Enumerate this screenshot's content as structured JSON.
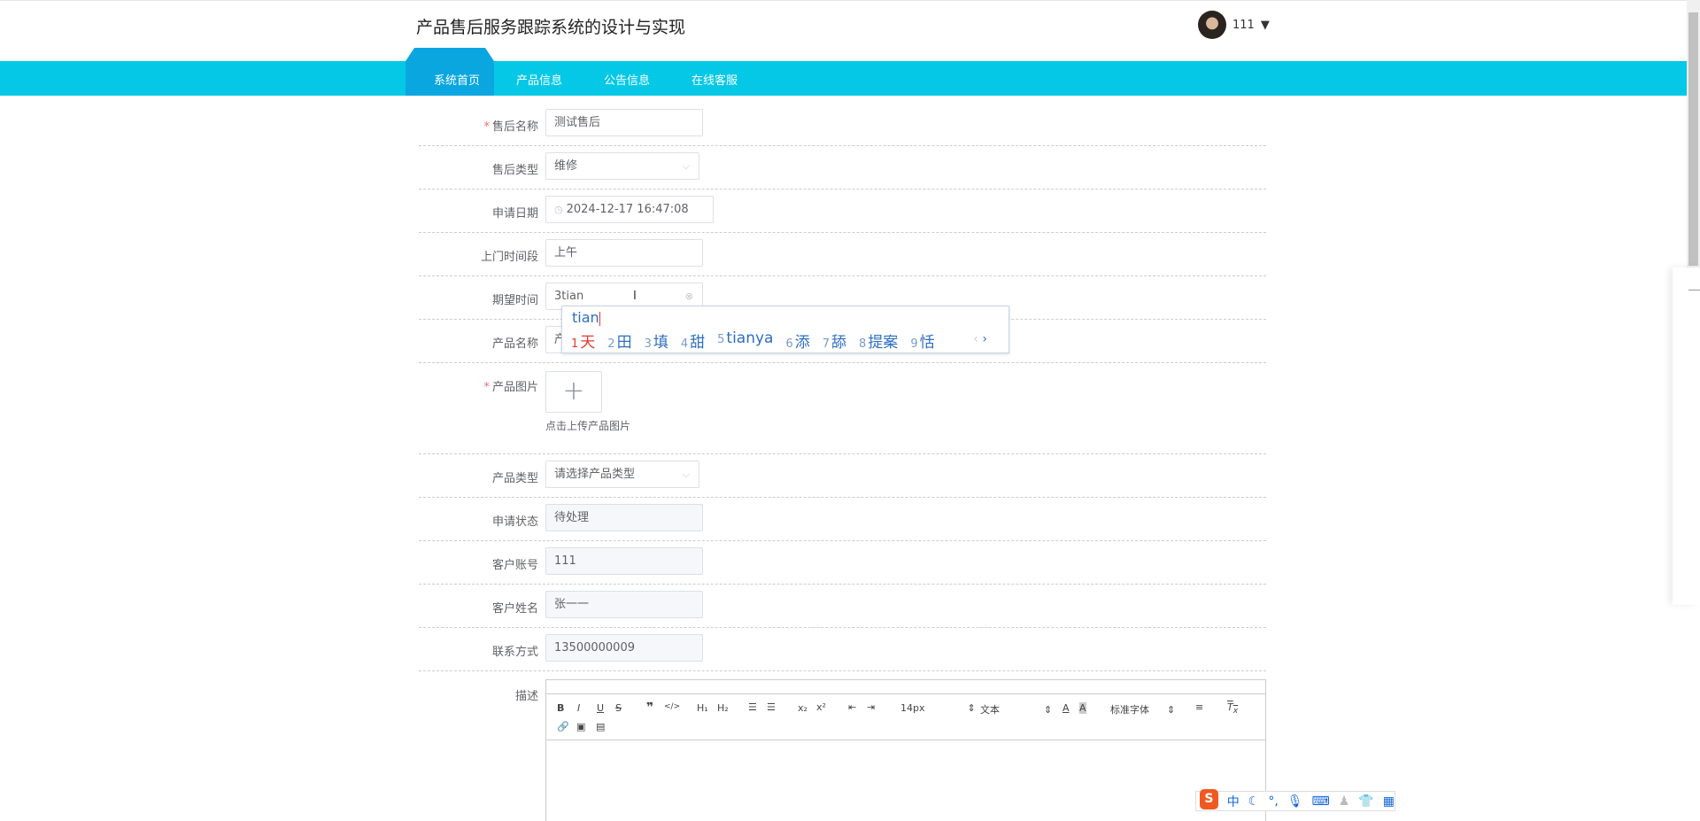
{
  "header": {
    "title": "产品售后服务跟踪系统的设计与实现",
    "user": "111"
  },
  "nav": {
    "tabs": [
      "系统首页",
      "产品信息",
      "公告信息",
      "在线客服"
    ]
  },
  "form": {
    "after_sale_name": {
      "label": "售后名称",
      "value": "测试售后"
    },
    "after_sale_type": {
      "label": "售后类型",
      "value": "维修"
    },
    "apply_date": {
      "label": "申请日期",
      "value": "2024-12-17 16:47:08"
    },
    "visit_period": {
      "label": "上门时间段",
      "value": "上午"
    },
    "expected_time": {
      "label": "期望时间",
      "value": "3tian"
    },
    "product_name": {
      "label": "产品名称",
      "value": "产"
    },
    "product_image": {
      "label": "产品图片",
      "hint": "点击上传产品图片"
    },
    "product_type": {
      "label": "产品类型",
      "placeholder": "请选择产品类型"
    },
    "apply_status": {
      "label": "申请状态",
      "value": "待处理"
    },
    "customer_account": {
      "label": "客户账号",
      "value": "111"
    },
    "customer_name": {
      "label": "客户姓名",
      "value": "张一一"
    },
    "contact": {
      "label": "联系方式",
      "value": "13500000009"
    },
    "description": {
      "label": "描述"
    }
  },
  "editor": {
    "font_size": "14px",
    "header_select": "文本",
    "font_select": "标准字体"
  },
  "ime": {
    "composition": "tian",
    "candidates": [
      {
        "n": "1",
        "t": "天"
      },
      {
        "n": "2",
        "t": "田"
      },
      {
        "n": "3",
        "t": "填"
      },
      {
        "n": "4",
        "t": "甜"
      },
      {
        "n": "5",
        "t": "tianya"
      },
      {
        "n": "6",
        "t": "添"
      },
      {
        "n": "7",
        "t": "舔"
      },
      {
        "n": "8",
        "t": "提案"
      },
      {
        "n": "9",
        "t": "恬"
      }
    ],
    "bar": {
      "logo": "S",
      "mode": "中"
    }
  }
}
